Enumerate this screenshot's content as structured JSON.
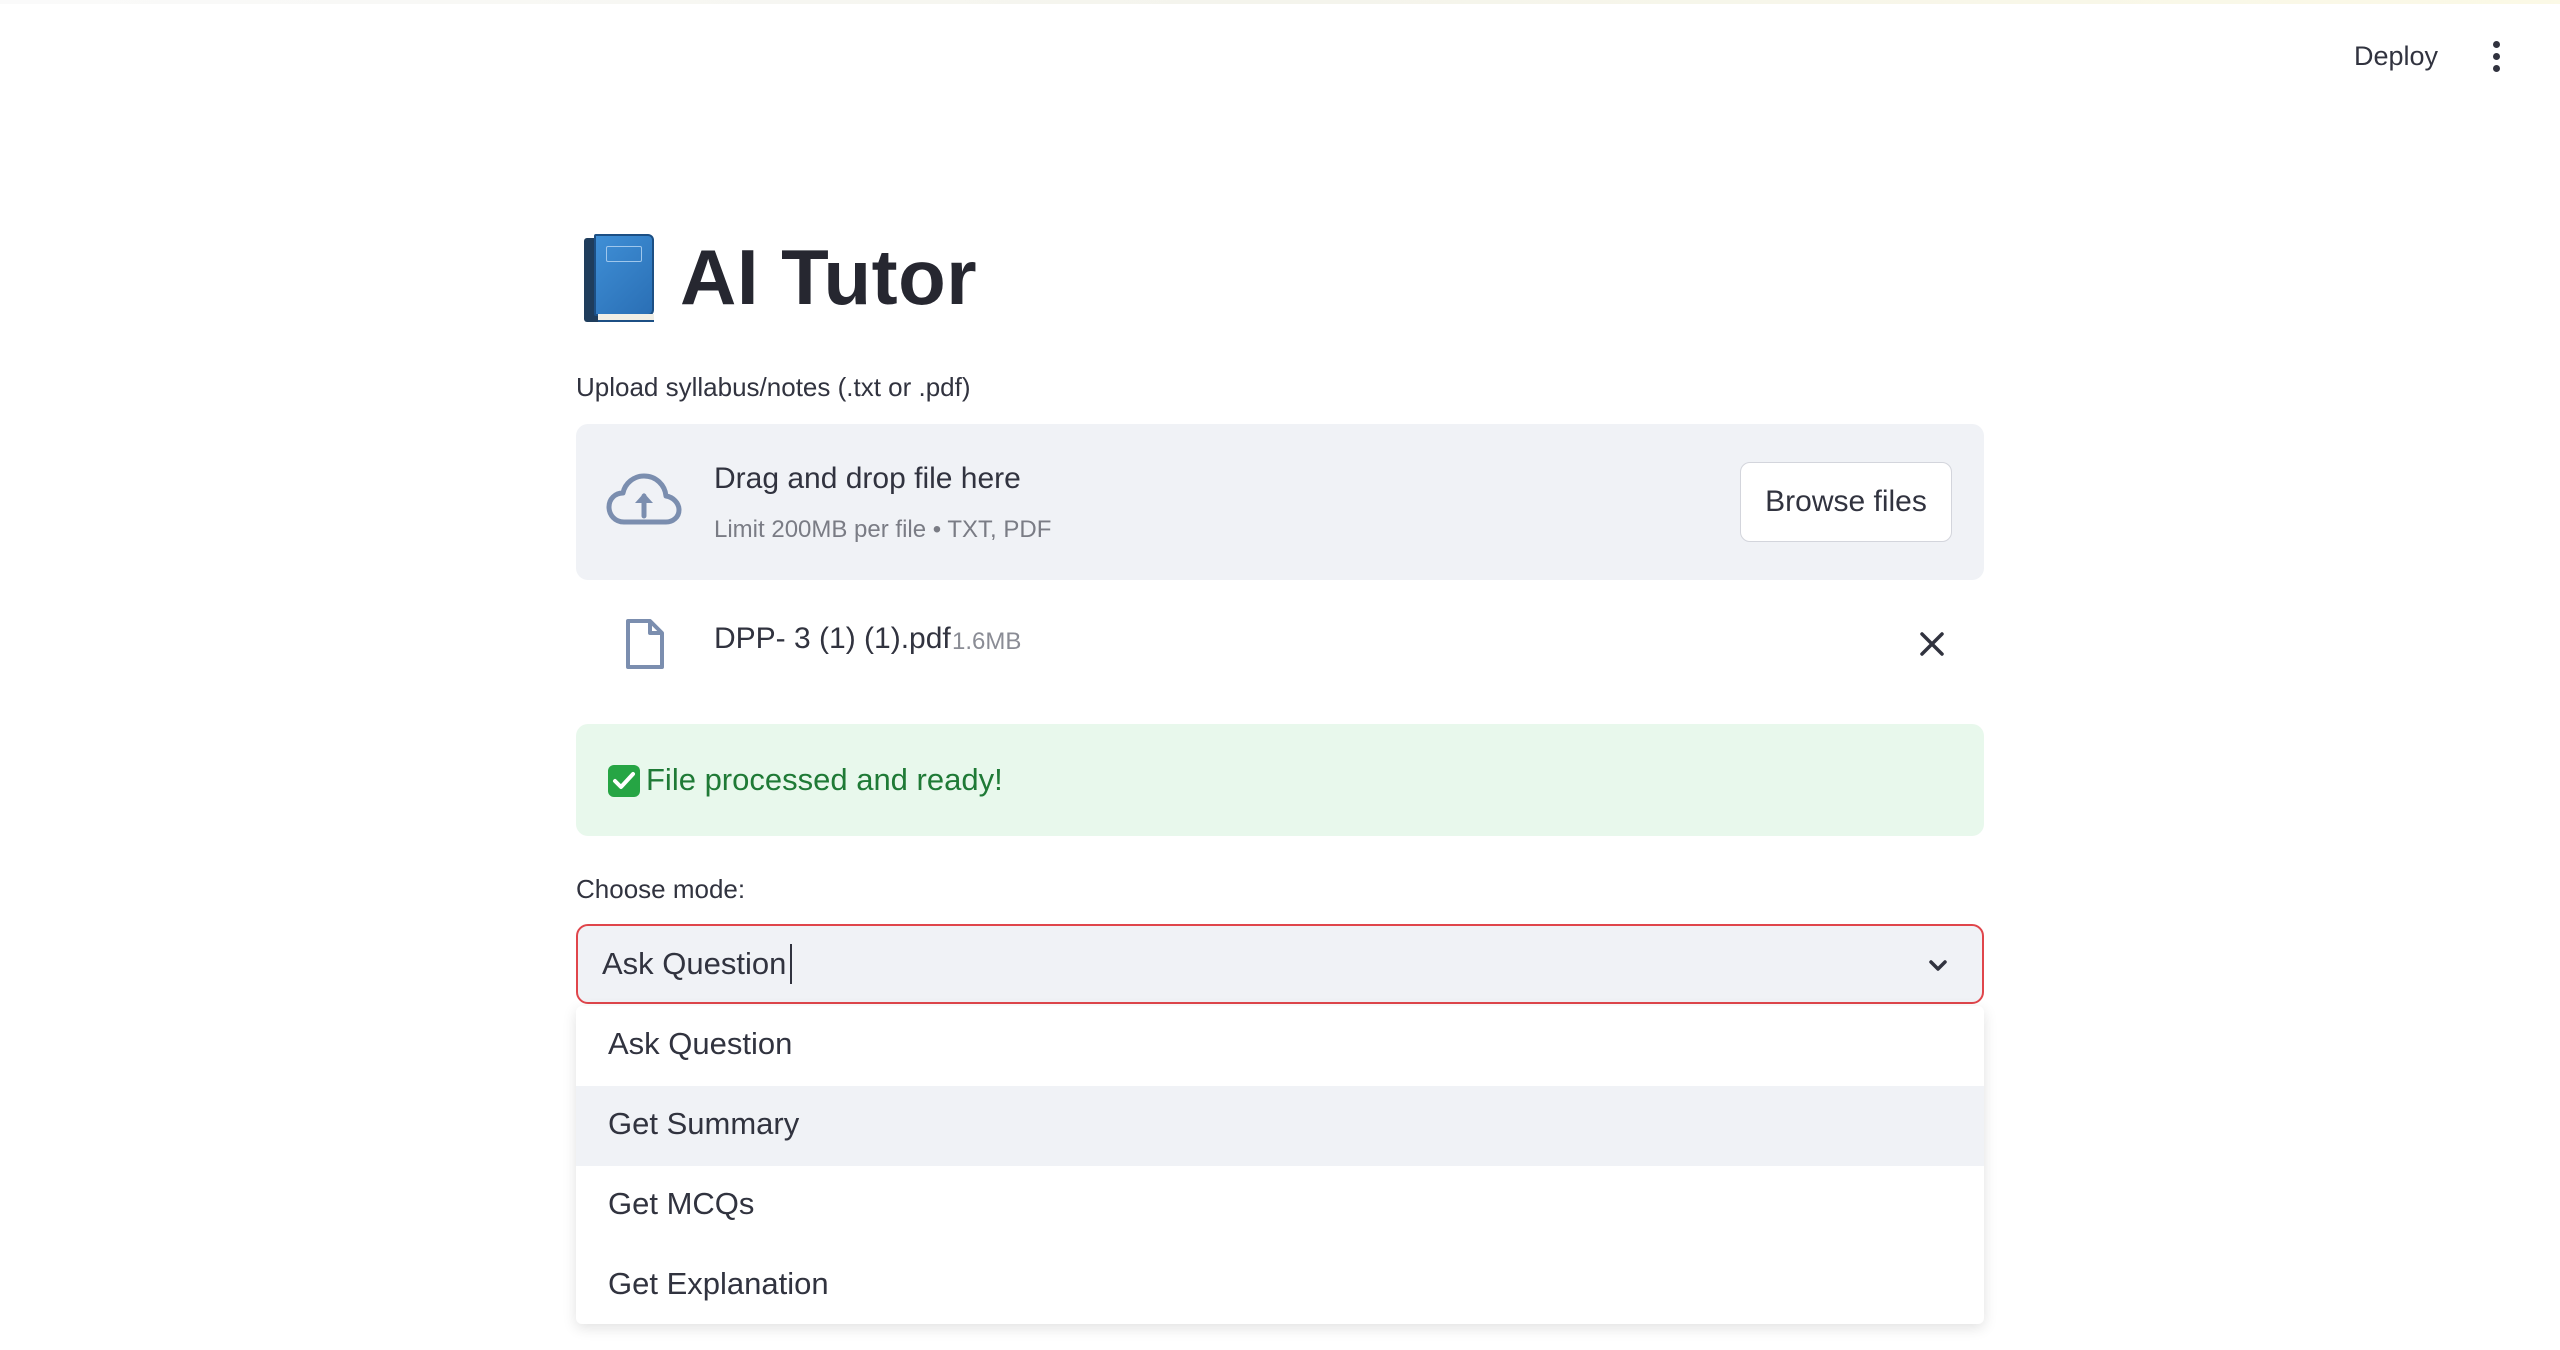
{
  "header": {
    "deploy_label": "Deploy",
    "menu_icon": "kebab-menu-icon"
  },
  "app": {
    "title": "AI Tutor",
    "title_icon": "blue-book-icon"
  },
  "uploader": {
    "label": "Upload syllabus/notes (.txt or .pdf)",
    "dropzone_title": "Drag and drop file here",
    "dropzone_subtitle": "Limit 200MB per file • TXT, PDF",
    "browse_label": "Browse files",
    "icon": "cloud-upload-icon"
  },
  "uploaded_file": {
    "name": "DPP- 3 (1) (1).pdf",
    "size": "1.6MB",
    "icon": "file-icon"
  },
  "status": {
    "message": "File processed and ready!",
    "icon": "check-mark-icon",
    "color": "#1f7a36"
  },
  "mode": {
    "label": "Choose mode:",
    "selected": "Ask Question",
    "options": [
      {
        "label": "Ask Question"
      },
      {
        "label": "Get Summary"
      },
      {
        "label": "Get MCQs"
      },
      {
        "label": "Get Explanation"
      }
    ],
    "highlighted_index": 1,
    "focus_border_color": "#e0454b"
  }
}
